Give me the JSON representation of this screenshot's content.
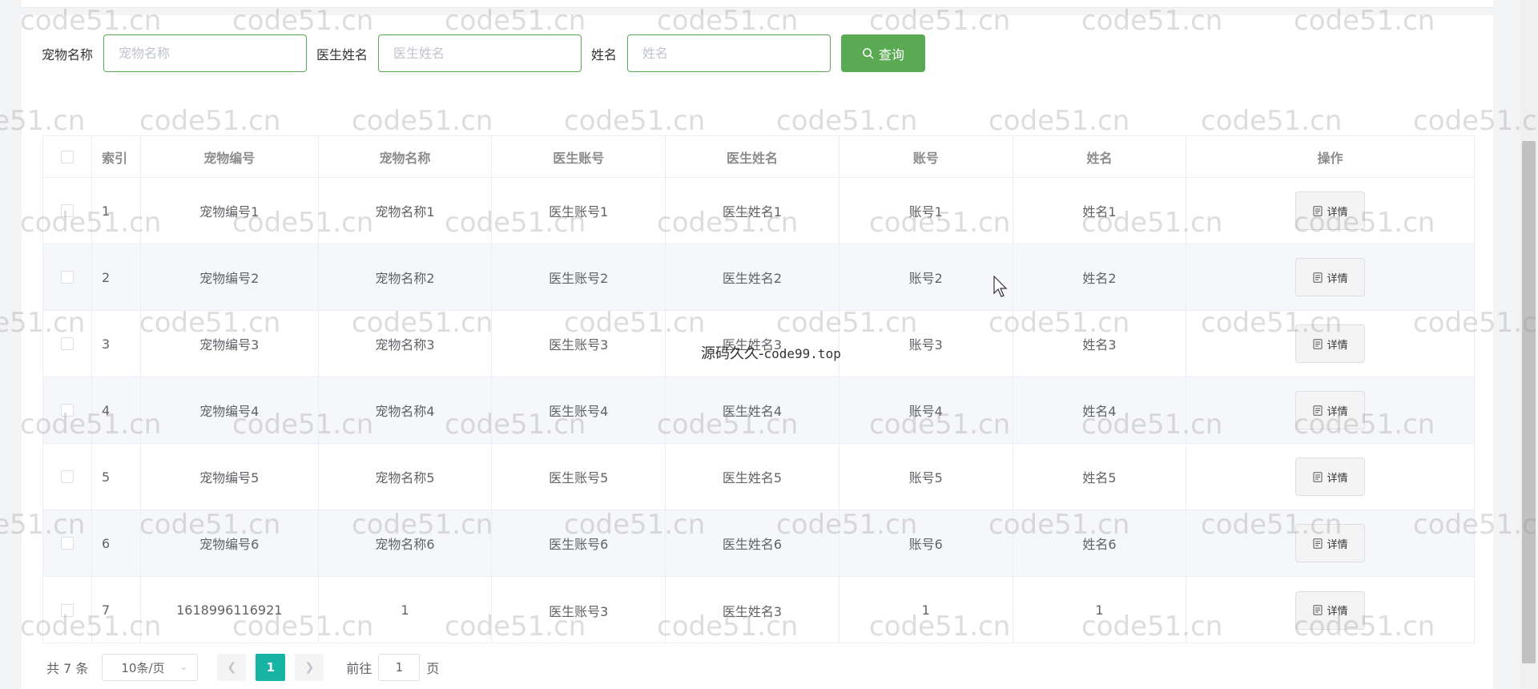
{
  "search": {
    "pet_name_label": "宠物名称",
    "pet_name_placeholder": "宠物名称",
    "doctor_name_label": "医生姓名",
    "doctor_name_placeholder": "医生姓名",
    "name_label": "姓名",
    "name_placeholder": "姓名",
    "query_button": "查询"
  },
  "table": {
    "headers": [
      "索引",
      "宠物编号",
      "宠物名称",
      "医生账号",
      "医生姓名",
      "账号",
      "姓名",
      "操作"
    ],
    "detail_label": "详情",
    "rows": [
      [
        "1",
        "宠物编号1",
        "宠物名称1",
        "医生账号1",
        "医生姓名1",
        "账号1",
        "姓名1"
      ],
      [
        "2",
        "宠物编号2",
        "宠物名称2",
        "医生账号2",
        "医生姓名2",
        "账号2",
        "姓名2"
      ],
      [
        "3",
        "宠物编号3",
        "宠物名称3",
        "医生账号3",
        "医生姓名3",
        "账号3",
        "姓名3"
      ],
      [
        "4",
        "宠物编号4",
        "宠物名称4",
        "医生账号4",
        "医生姓名4",
        "账号4",
        "姓名4"
      ],
      [
        "5",
        "宠物编号5",
        "宠物名称5",
        "医生账号5",
        "医生姓名5",
        "账号5",
        "姓名5"
      ],
      [
        "6",
        "宠物编号6",
        "宠物名称6",
        "医生账号6",
        "医生姓名6",
        "账号6",
        "姓名6"
      ],
      [
        "7",
        "1618996116921",
        "1",
        "医生账号3",
        "医生姓名3",
        "1",
        "1"
      ]
    ]
  },
  "pagination": {
    "total": "共 7 条",
    "page_size": "10条/页",
    "current_page": "1",
    "goto_label": "前往",
    "goto_value": "1",
    "page_suffix": "页"
  },
  "overlay": {
    "watermark": "code51.cn",
    "center_text_cn": "源码久久-",
    "center_text_url": "code99.top"
  },
  "colors": {
    "accent_green": "#5aa953",
    "page_active": "#17b3a3"
  },
  "icons": {
    "query": "search-icon",
    "detail": "document-icon",
    "prev": "chevron-left-icon",
    "next": "chevron-right-icon",
    "select": "chevron-down-icon"
  }
}
